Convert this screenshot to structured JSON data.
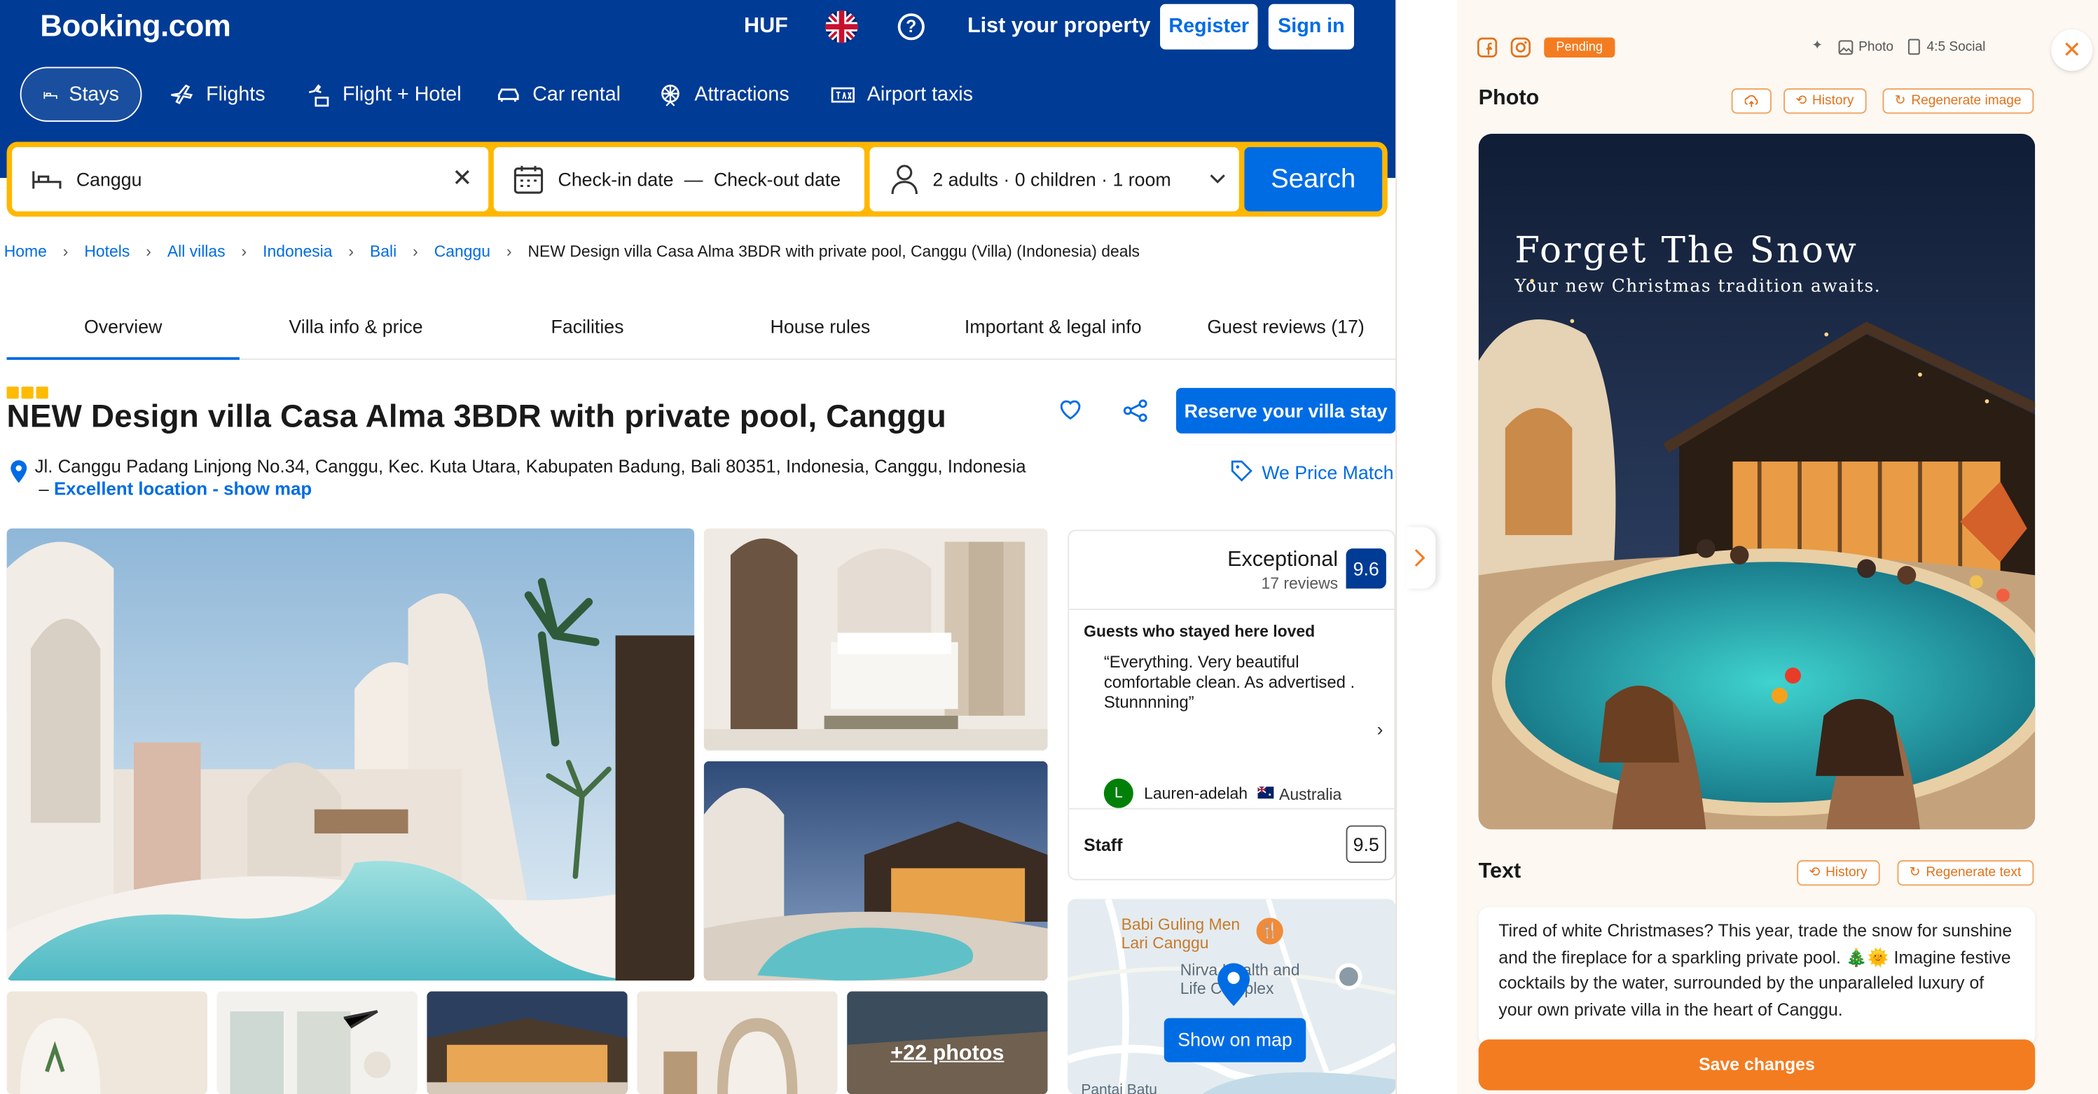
{
  "header": {
    "logo": "Booking.com",
    "currency": "HUF",
    "list_property": "List your property",
    "register": "Register",
    "sign_in": "Sign in"
  },
  "nav": [
    "Stays",
    "Flights",
    "Flight + Hotel",
    "Car rental",
    "Attractions",
    "Airport taxis"
  ],
  "search": {
    "destination": "Canggu",
    "checkin": "Check-in date",
    "dash": "—",
    "checkout": "Check-out date",
    "guests": "2 adults · 0 children · 1 room",
    "button": "Search"
  },
  "breadcrumbs": [
    "Home",
    "Hotels",
    "All villas",
    "Indonesia",
    "Bali",
    "Canggu"
  ],
  "breadcrumb_current": "NEW Design villa Casa Alma 3BDR with private pool, Canggu (Villa) (Indonesia) deals",
  "tabs": [
    "Overview",
    "Villa info & price",
    "Facilities",
    "House rules",
    "Important & legal info",
    "Guest reviews (17)"
  ],
  "property": {
    "title": "NEW Design villa Casa Alma 3BDR with private pool, Canggu",
    "address": "Jl. Canggu Padang Linjong No.34, Canggu, Kec. Kuta Utara, Kabupaten Badung, Bali 80351, Indonesia, Canggu, Indonesia",
    "address_dash": "–",
    "location_link": "Excellent location - show map",
    "reserve": "Reserve your villa stay",
    "price_match": "We Price Match",
    "more_photos": "+22 photos"
  },
  "review": {
    "rating_word": "Exceptional",
    "count": "17 reviews",
    "score": "9.6",
    "loved_label": "Guests who stayed here loved",
    "quote": "“Everything. Very beautiful comfortable clean. As advertised . Stunnnning”",
    "reviewer_initial": "L",
    "reviewer": "Lauren-adelah",
    "country": "Australia",
    "staff_label": "Staff",
    "staff_score": "9.5"
  },
  "map": {
    "poi1": "Babi Guling Men",
    "poi1b": "Lari Canggu",
    "poi2": "Nirva",
    "poi2b": "Health and",
    "poi2c": "Life",
    "poi2d": "Complex",
    "poi3": "Pantai Batu",
    "button": "Show on map"
  },
  "panel": {
    "status": "Pending",
    "mode_photo": "Photo",
    "mode_format": "4:5 Social",
    "photo_title": "Photo",
    "history": "History",
    "regenerate_image": "Regenerate image",
    "headline": "Forget The Snow",
    "subline": "Your new Christmas tradition awaits.",
    "text_title": "Text",
    "regenerate_text": "Regenerate text",
    "body": "Tired of white Christmases? This year, trade the snow for sunshine and the fireplace for a sparkling private pool. 🎄🌞 Imagine festive cocktails by the water, surrounded by the unparalleled luxury of your own private villa in the heart of Canggu.",
    "save": "Save changes"
  },
  "colors": {
    "brand": "#003b95",
    "accent": "#006ce4",
    "search_border": "#ffb700",
    "panel_accent": "#f47c20"
  }
}
